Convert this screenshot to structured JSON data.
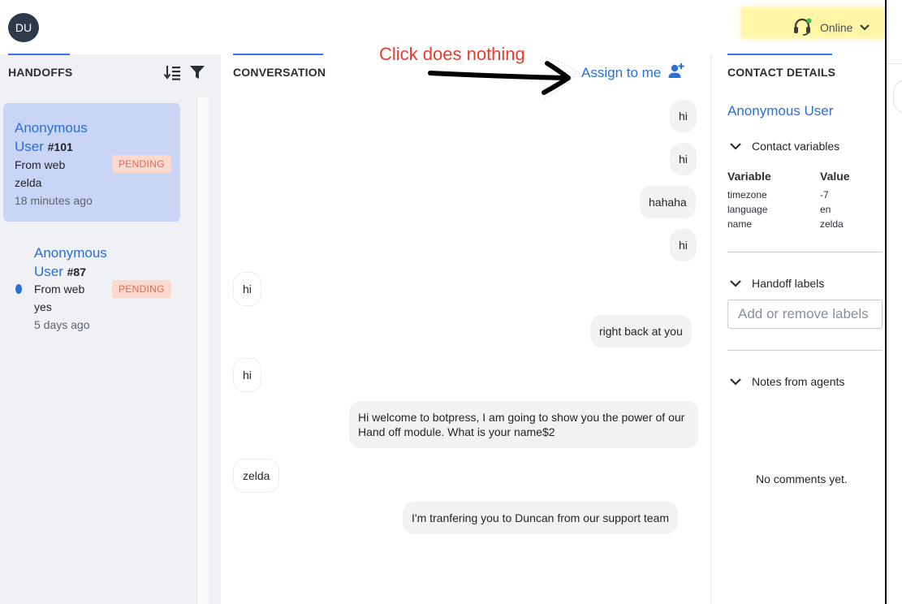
{
  "topbar": {
    "avatar_initials": "DU",
    "status_label": "Online",
    "status_color": "#b8a800"
  },
  "handoffs": {
    "title": "HANDOFFS",
    "items": [
      {
        "name_line1": "Anonymous",
        "name_line2": "User",
        "number": "#101",
        "source": "From web",
        "preview": "zelda",
        "time": "18 minutes ago",
        "badge": "PENDING",
        "unread": false
      },
      {
        "name_line1": "Anonymous",
        "name_line2": "User",
        "number": "#87",
        "source": "From web",
        "preview": "yes",
        "time": "5 days ago",
        "badge": "PENDING",
        "unread": true
      }
    ]
  },
  "conversation": {
    "title": "CONVERSATION",
    "assign_label": "Assign to me",
    "annotation": "Click does nothing",
    "messages": [
      {
        "side": "out",
        "text": "hi"
      },
      {
        "side": "out",
        "text": "hi"
      },
      {
        "side": "out",
        "text": "hahaha"
      },
      {
        "side": "out",
        "text": "hi"
      },
      {
        "side": "in",
        "text": "hi"
      },
      {
        "side": "out",
        "text": "right back at you"
      },
      {
        "side": "in",
        "text": "hi"
      },
      {
        "side": "out",
        "text": "Hi welcome to botpress, I am going to show you the power of our Hand off module. What is your name$2"
      },
      {
        "side": "in",
        "text": "zelda"
      },
      {
        "side": "out",
        "text": "I'm tranfering you to Duncan from our support team"
      }
    ]
  },
  "contact": {
    "title": "CONTACT DETAILS",
    "user_name": "Anonymous User",
    "variables_header": "Contact variables",
    "col_variable": "Variable",
    "col_value": "Value",
    "variables": [
      {
        "name": "timezone",
        "value": "-7"
      },
      {
        "name": "language",
        "value": "en"
      },
      {
        "name": "name",
        "value": "zelda"
      }
    ],
    "labels_header": "Handoff labels",
    "labels_placeholder": "Add or remove labels",
    "notes_header": "Notes from agents",
    "no_comments": "No comments yet."
  },
  "colors": {
    "accent": "#3b73e6",
    "link": "#2b6ed8",
    "badge_text": "#e36b4f",
    "badge_bg": "#fbd9cf",
    "active_card": "#c9d5f5",
    "annotation": "#ea3b2e"
  }
}
